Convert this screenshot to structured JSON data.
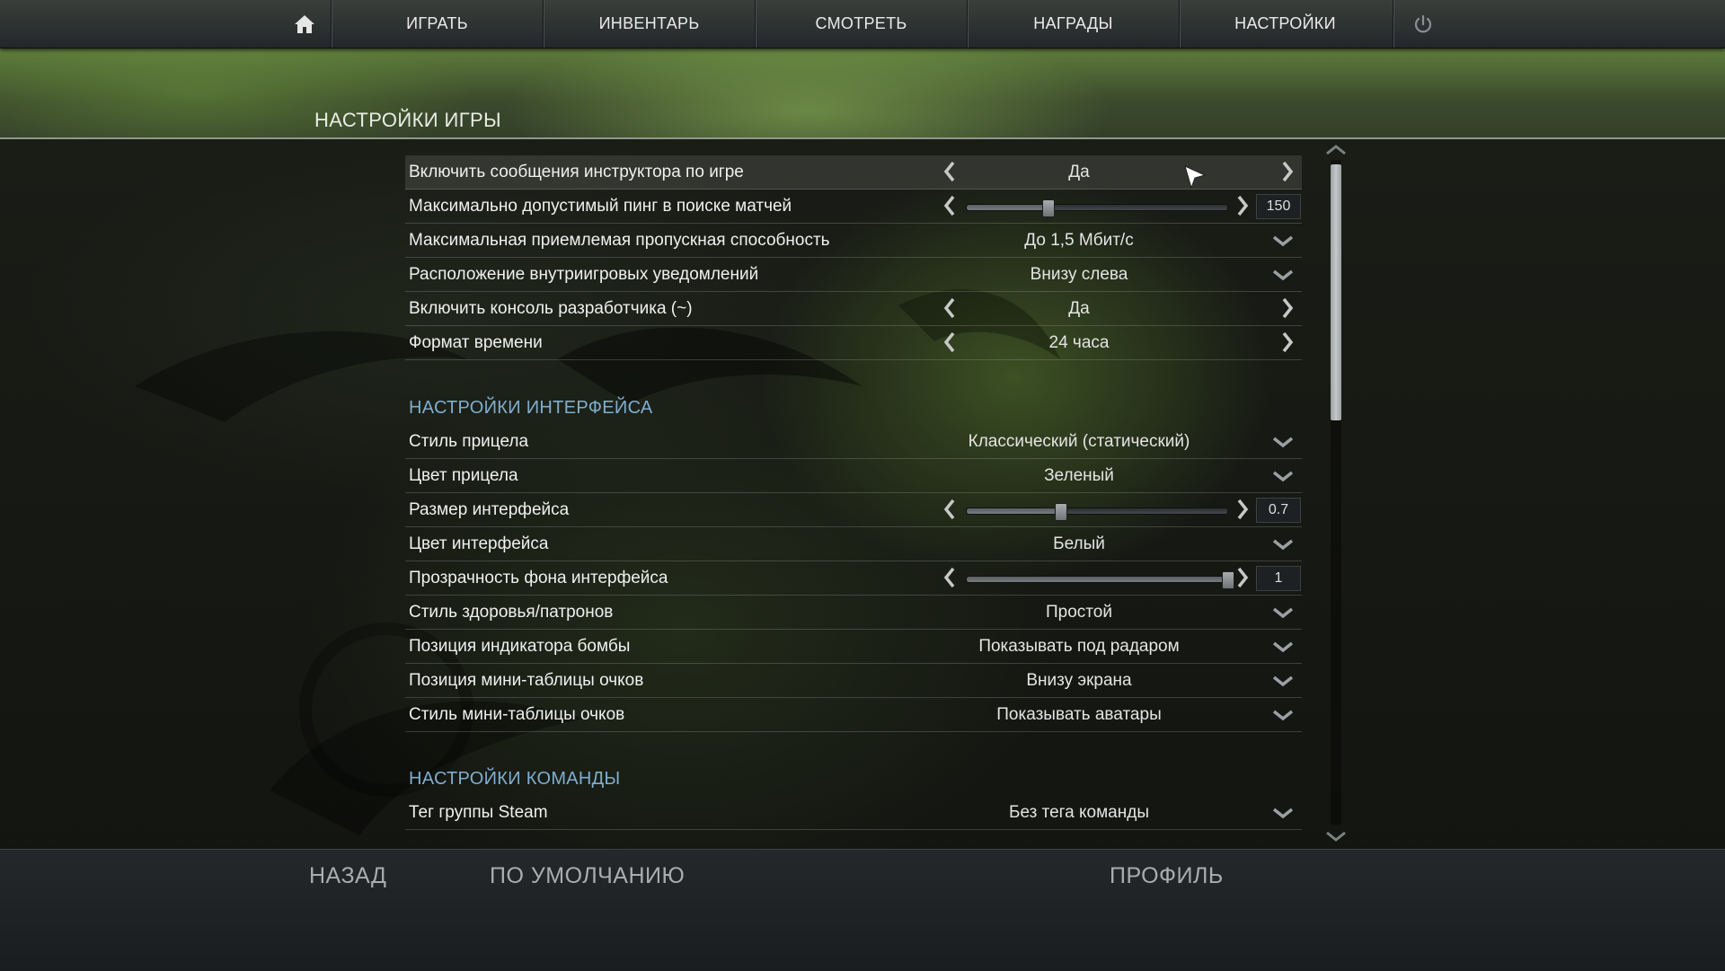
{
  "nav": {
    "home_icon": "home-icon",
    "items": [
      "ИГРАТЬ",
      "ИНВЕНТАРЬ",
      "СМОТРЕТЬ",
      "НАГРАДЫ",
      "НАСТРОЙКИ"
    ],
    "power_icon": "power-icon"
  },
  "page": {
    "title": "НАСТРОЙКИ ИГРЫ"
  },
  "game_settings": [
    {
      "label": "Включить сообщения инструктора по игре",
      "control": "toggle",
      "value": "Да"
    },
    {
      "label": "Максимально допустимый пинг в поиске матчей",
      "control": "slider",
      "value": "150",
      "fraction": 0.31
    },
    {
      "label": "Максимальная приемлемая пропускная способность",
      "control": "dropdown",
      "value": "До 1,5 Мбит/с"
    },
    {
      "label": "Расположение внутриигровых уведомлений",
      "control": "dropdown",
      "value": "Внизу слева"
    },
    {
      "label": "Включить консоль разработчика (~)",
      "control": "toggle",
      "value": "Да"
    },
    {
      "label": "Формат времени",
      "control": "toggle",
      "value": "24 часа"
    }
  ],
  "interface_section": {
    "title": "НАСТРОЙКИ ИНТЕРФЕЙСА"
  },
  "interface_settings": [
    {
      "label": "Стиль прицела",
      "control": "dropdown",
      "value": "Классический (статический)"
    },
    {
      "label": "Цвет прицела",
      "control": "dropdown",
      "value": "Зеленый"
    },
    {
      "label": "Размер интерфейса",
      "control": "slider",
      "value": "0.7",
      "fraction": 0.36
    },
    {
      "label": "Цвет интерфейса",
      "control": "dropdown",
      "value": "Белый"
    },
    {
      "label": "Прозрачность фона интерфейса",
      "control": "slider",
      "value": "1",
      "fraction": 1.0
    },
    {
      "label": "Стиль здоровья/патронов",
      "control": "dropdown",
      "value": "Простой"
    },
    {
      "label": "Позиция индикатора бомбы",
      "control": "dropdown",
      "value": "Показывать под радаром"
    },
    {
      "label": "Позиция мини-таблицы очков",
      "control": "dropdown",
      "value": "Внизу экрана"
    },
    {
      "label": "Стиль мини-таблицы очков",
      "control": "dropdown",
      "value": "Показывать аватары"
    }
  ],
  "team_section": {
    "title": "НАСТРОЙКИ КОМАНДЫ"
  },
  "team_settings": [
    {
      "label": "Тег группы Steam",
      "control": "dropdown",
      "value": "Без тега команды"
    }
  ],
  "bottom": {
    "back": "НАЗАД",
    "defaults": "ПО УМОЛЧАНИЮ",
    "profile": "ПРОФИЛЬ"
  },
  "colors": {
    "section_title": "#7faecf",
    "header_green": "#5f7d3c",
    "nav_bg": "#2e3336"
  }
}
